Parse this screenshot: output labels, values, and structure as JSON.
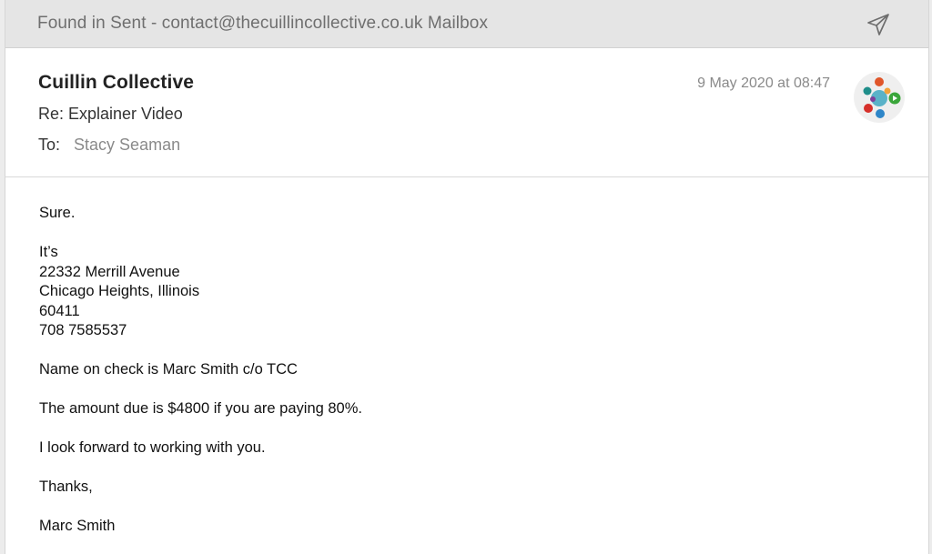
{
  "window": {
    "title": "Found in Sent - contact@thecuillincollective.co.uk Mailbox",
    "send_icon": "paper-plane-icon"
  },
  "message": {
    "sender": "Cuillin Collective",
    "subject": "Re: Explainer Video",
    "to_label": "To:",
    "to_value": "Stacy Seaman",
    "date": "9 May 2020 at 08:47",
    "avatar": "sender-avatar-logo"
  },
  "body": {
    "p1": "Sure.",
    "address_lines": [
      "It’s",
      "22332 Merrill Avenue",
      "Chicago Heights, Illinois",
      "60411",
      "708 7585537"
    ],
    "p3": "Name on check is Marc Smith c/o TCC",
    "p4": "The amount due is $4800 if you are paying 80%.",
    "p5": "I look forward to working with you.",
    "p6": "Thanks,",
    "p7": "Marc Smith"
  },
  "colors": {
    "titlebar_bg": "#e5e5e5",
    "muted_text": "#8a8a8a"
  }
}
